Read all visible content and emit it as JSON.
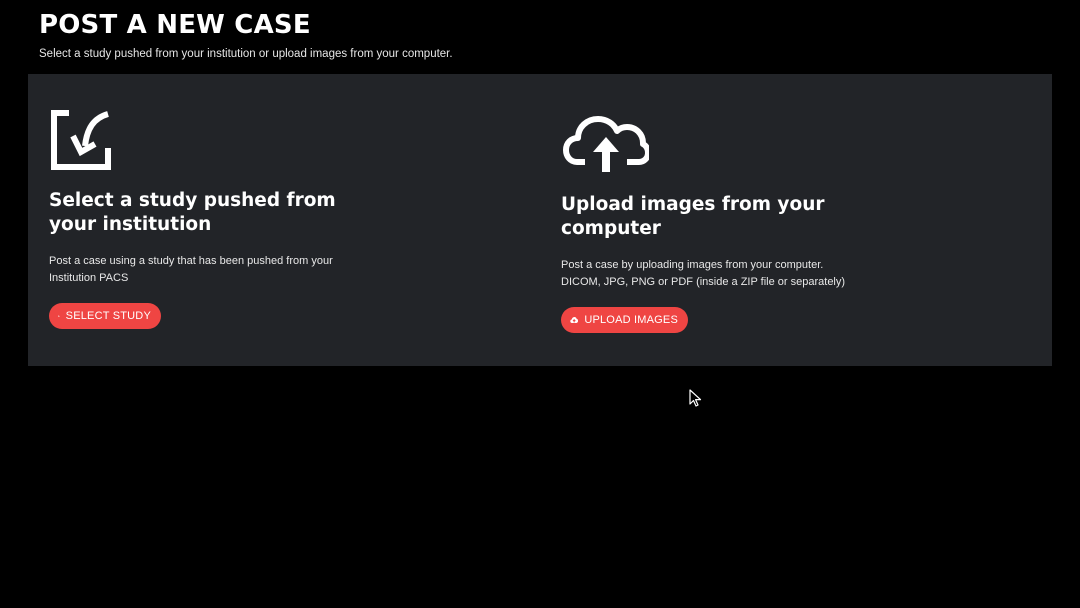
{
  "header": {
    "title": "POST A NEW CASE",
    "subtitle": "Select a study pushed from your institution or upload images from your computer."
  },
  "options": {
    "institution": {
      "icon": "import-arrow-icon",
      "title": "Select a study pushed from your institution",
      "description_lines": [
        "Post a case using a study that has been pushed from your",
        "Institution PACS"
      ],
      "button_icon": "folder-open-icon",
      "button_label": "SELECT STUDY"
    },
    "upload": {
      "icon": "cloud-upload-icon",
      "title": "Upload images from your computer",
      "description_lines": [
        "Post a case by uploading images from your computer.",
        "DICOM, JPG, PNG or PDF (inside a ZIP file or separately)"
      ],
      "button_icon": "cloud-upload-icon",
      "button_label": "UPLOAD IMAGES"
    }
  },
  "colors": {
    "background": "#000000",
    "panel": "#222428",
    "accent": "#ef4543",
    "text": "#ffffff"
  }
}
